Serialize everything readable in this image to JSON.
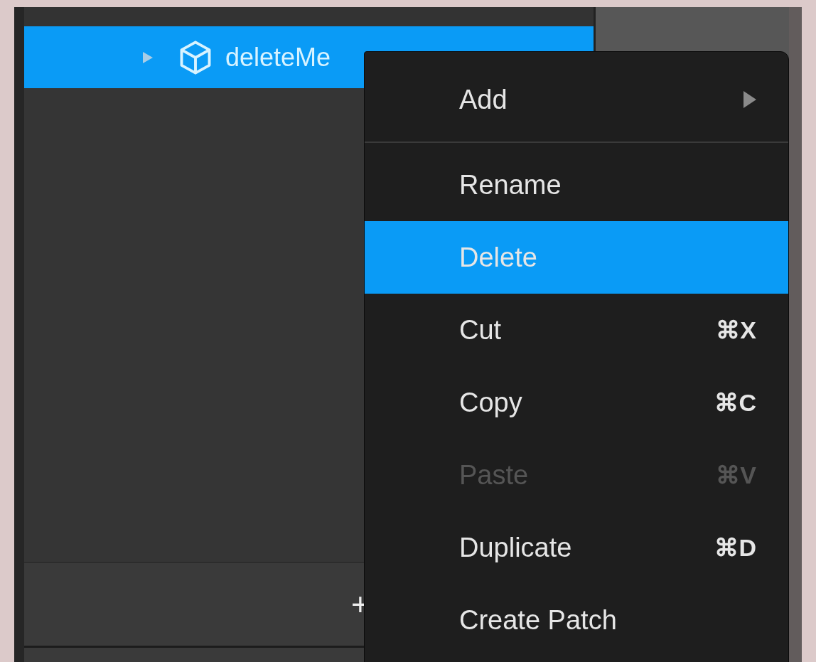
{
  "tree": {
    "items": [
      {
        "label": "deleteMe",
        "selected": true,
        "expanded": false
      }
    ]
  },
  "footer": {
    "add_button": "+"
  },
  "context_menu": {
    "items": [
      {
        "kind": "submenu",
        "label": "Add",
        "selected": false,
        "disabled": false
      },
      {
        "kind": "separator"
      },
      {
        "kind": "item",
        "label": "Rename",
        "selected": false,
        "disabled": false
      },
      {
        "kind": "item",
        "label": "Delete",
        "selected": true,
        "disabled": false
      },
      {
        "kind": "item",
        "label": "Cut",
        "shortcut": "⌘X",
        "selected": false,
        "disabled": false
      },
      {
        "kind": "item",
        "label": "Copy",
        "shortcut": "⌘C",
        "selected": false,
        "disabled": false
      },
      {
        "kind": "item",
        "label": "Paste",
        "shortcut": "⌘V",
        "selected": false,
        "disabled": true
      },
      {
        "kind": "item",
        "label": "Duplicate",
        "shortcut": "⌘D",
        "selected": false,
        "disabled": false
      },
      {
        "kind": "item",
        "label": "Create Patch",
        "selected": false,
        "disabled": false
      }
    ]
  }
}
